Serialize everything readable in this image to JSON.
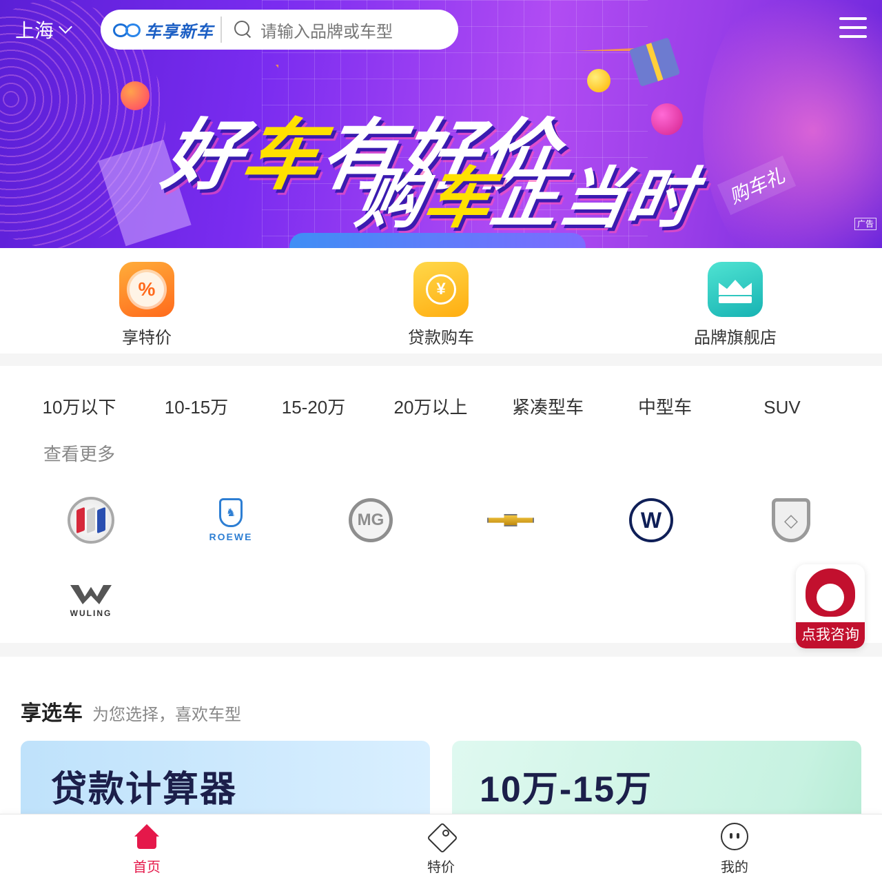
{
  "header": {
    "city": "上海",
    "logo_text": "车享新车",
    "search_placeholder": "请输入品牌或车型"
  },
  "banner": {
    "slogan_line1_a": "好",
    "slogan_line1_b": "车",
    "slogan_line1_c": "有好价",
    "slogan_line2_a": "购",
    "slogan_line2_b": "车",
    "slogan_line2_c": "正当时",
    "tag": "购车礼",
    "ad_label": "广告",
    "colors": {
      "highlight": "#ffe100",
      "text": "#ffffff"
    }
  },
  "quick_entries": [
    {
      "label": "享特价",
      "icon": "discount-icon"
    },
    {
      "label": "贷款购车",
      "icon": "loan-coin-icon"
    },
    {
      "label": "品牌旗舰店",
      "icon": "crown-icon"
    }
  ],
  "filters": [
    "10万以下",
    "10-15万",
    "15-20万",
    "20万以上",
    "紧凑型车",
    "中型车",
    "SUV"
  ],
  "filter_more": "查看更多",
  "brands": {
    "roewe": "ROEWE",
    "mg": "MG",
    "vw": "W",
    "wuling": "WULING"
  },
  "section": {
    "title": "享选车",
    "subtitle": "为您选择，喜欢车型",
    "cards": [
      "贷款计算器",
      "10万-15万"
    ]
  },
  "consult": {
    "label": "点我咨询"
  },
  "tabbar": [
    {
      "label": "首页",
      "active": true
    },
    {
      "label": "特价",
      "active": false
    },
    {
      "label": "我的",
      "active": false
    }
  ],
  "colors": {
    "accent": "#e5184a",
    "consult": "#c2102e",
    "logo_blue": "#1c5fc4"
  }
}
